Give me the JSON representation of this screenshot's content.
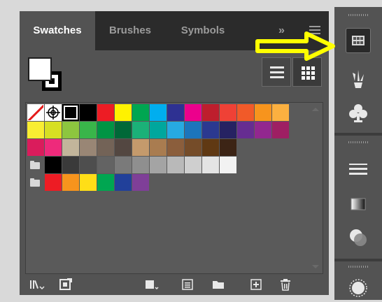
{
  "tabs": [
    {
      "label": "Swatches",
      "active": true
    },
    {
      "label": "Brushes",
      "active": false
    },
    {
      "label": "Symbols",
      "active": false
    }
  ],
  "tab_overflow_icon": "double-chevron-icon",
  "panel_menu_icon": "hamburger-menu-icon",
  "fill_color": "#ffffff",
  "stroke_color": "#000000",
  "view_modes": [
    "list-view",
    "thumbnail-view"
  ],
  "active_view": "thumbnail-view",
  "swatch_rows": [
    [
      "none",
      "registration",
      "white-stroke",
      "#000000",
      "#ed1c24",
      "#fff200",
      "#00a651",
      "#00aeef",
      "#2e3192",
      "#ec008c",
      "#be1e2d",
      "#ef4136",
      "#f15a29",
      "#f7941d",
      "#fbb040"
    ],
    [
      "#f9ed32",
      "#d7df23",
      "#8dc63f",
      "#39b54a",
      "#009444",
      "#006838",
      "#1bb178",
      "#00a79d",
      "#27aae1",
      "#1c75bc",
      "#2b3990",
      "#262262",
      "#662d91",
      "#92278f",
      "#9e1f63"
    ],
    [
      "#da1c5c",
      "#ee2a7b",
      "#c2b59b",
      "#998675",
      "#736357",
      "#534741",
      "#c49a6c",
      "#a97c50",
      "#8b5e3c",
      "#754c29",
      "#603913",
      "#3c2415"
    ],
    [
      "folder",
      "#000000",
      "#3a3a3a",
      "#4e4e4e",
      "#636363",
      "#7a7a7a",
      "#8f8f8f",
      "#a4a4a4",
      "#b9b9b9",
      "#cfcfcf",
      "#e4e4e4",
      "#f2f2f2"
    ],
    [
      "folder",
      "#ed1c24",
      "#f7941d",
      "#ffde17",
      "#00a651",
      "#21409a",
      "#7f3f98"
    ]
  ],
  "bottom_toolbar": [
    "swatch-libraries-icon",
    "place-swatches-icon",
    "show-swatch-kinds-icon",
    "swatch-options-icon",
    "new-color-group-icon",
    "new-swatch-icon",
    "delete-swatch-icon"
  ],
  "dock_buttons": [
    {
      "icon": "swatches-icon",
      "selected": true
    },
    {
      "icon": "brushes-icon",
      "selected": false
    },
    {
      "icon": "symbols-club-icon",
      "selected": false
    },
    {
      "icon": "stroke-lines-icon",
      "selected": false
    },
    {
      "icon": "gradient-icon",
      "selected": false
    },
    {
      "icon": "transparency-icon",
      "selected": false
    },
    {
      "icon": "appearance-icon",
      "selected": false
    }
  ],
  "annotation_arrow_color": "#ffff00"
}
